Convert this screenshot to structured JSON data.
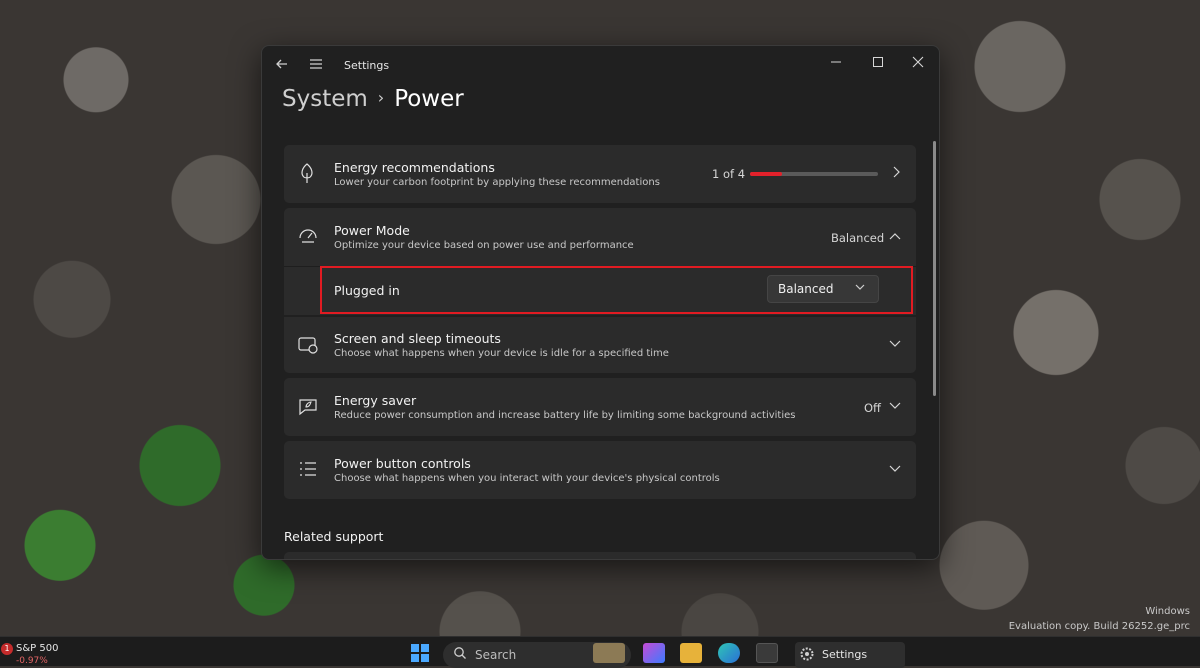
{
  "window": {
    "app_title": "Settings",
    "breadcrumb": {
      "parent": "System",
      "separator": "›",
      "current": "Power"
    }
  },
  "cards": [
    {
      "title": "Energy recommendations",
      "subtitle": "Lower your carbon footprint by applying these recommendations",
      "right_text": "1 of 4",
      "progress_fraction": 0.25,
      "icon": "leaf-icon"
    },
    {
      "title": "Power Mode",
      "subtitle": "Optimize your device based on power use and performance",
      "right_text": "Balanced",
      "icon": "power-mode-icon"
    },
    {
      "title": "Screen and sleep timeouts",
      "subtitle": "Choose what happens when your device is idle for a specified time",
      "icon": "screen-sleep-icon"
    },
    {
      "title": "Energy saver",
      "subtitle": "Reduce power consumption and increase battery life by limiting some background activities",
      "right_text": "Off",
      "icon": "energy-saver-icon"
    },
    {
      "title": "Power button controls",
      "subtitle": "Choose what happens when you interact with your device's physical controls",
      "icon": "power-button-icon"
    }
  ],
  "plugged_in": {
    "label": "Plugged in",
    "selected": "Balanced"
  },
  "related_support": "Related support",
  "taskbar": {
    "widget_label": "S&P 500",
    "widget_badge": "1",
    "widget_value": "-0.97%",
    "search_placeholder": "Search",
    "settings_label": "Settings"
  },
  "watermark": {
    "line1": "Windows",
    "line2": "Evaluation copy. Build 26252.ge_prc"
  },
  "colors": {
    "accent_red": "#e3212b",
    "card_bg": "#2b2b2b",
    "window_bg": "#202020"
  }
}
